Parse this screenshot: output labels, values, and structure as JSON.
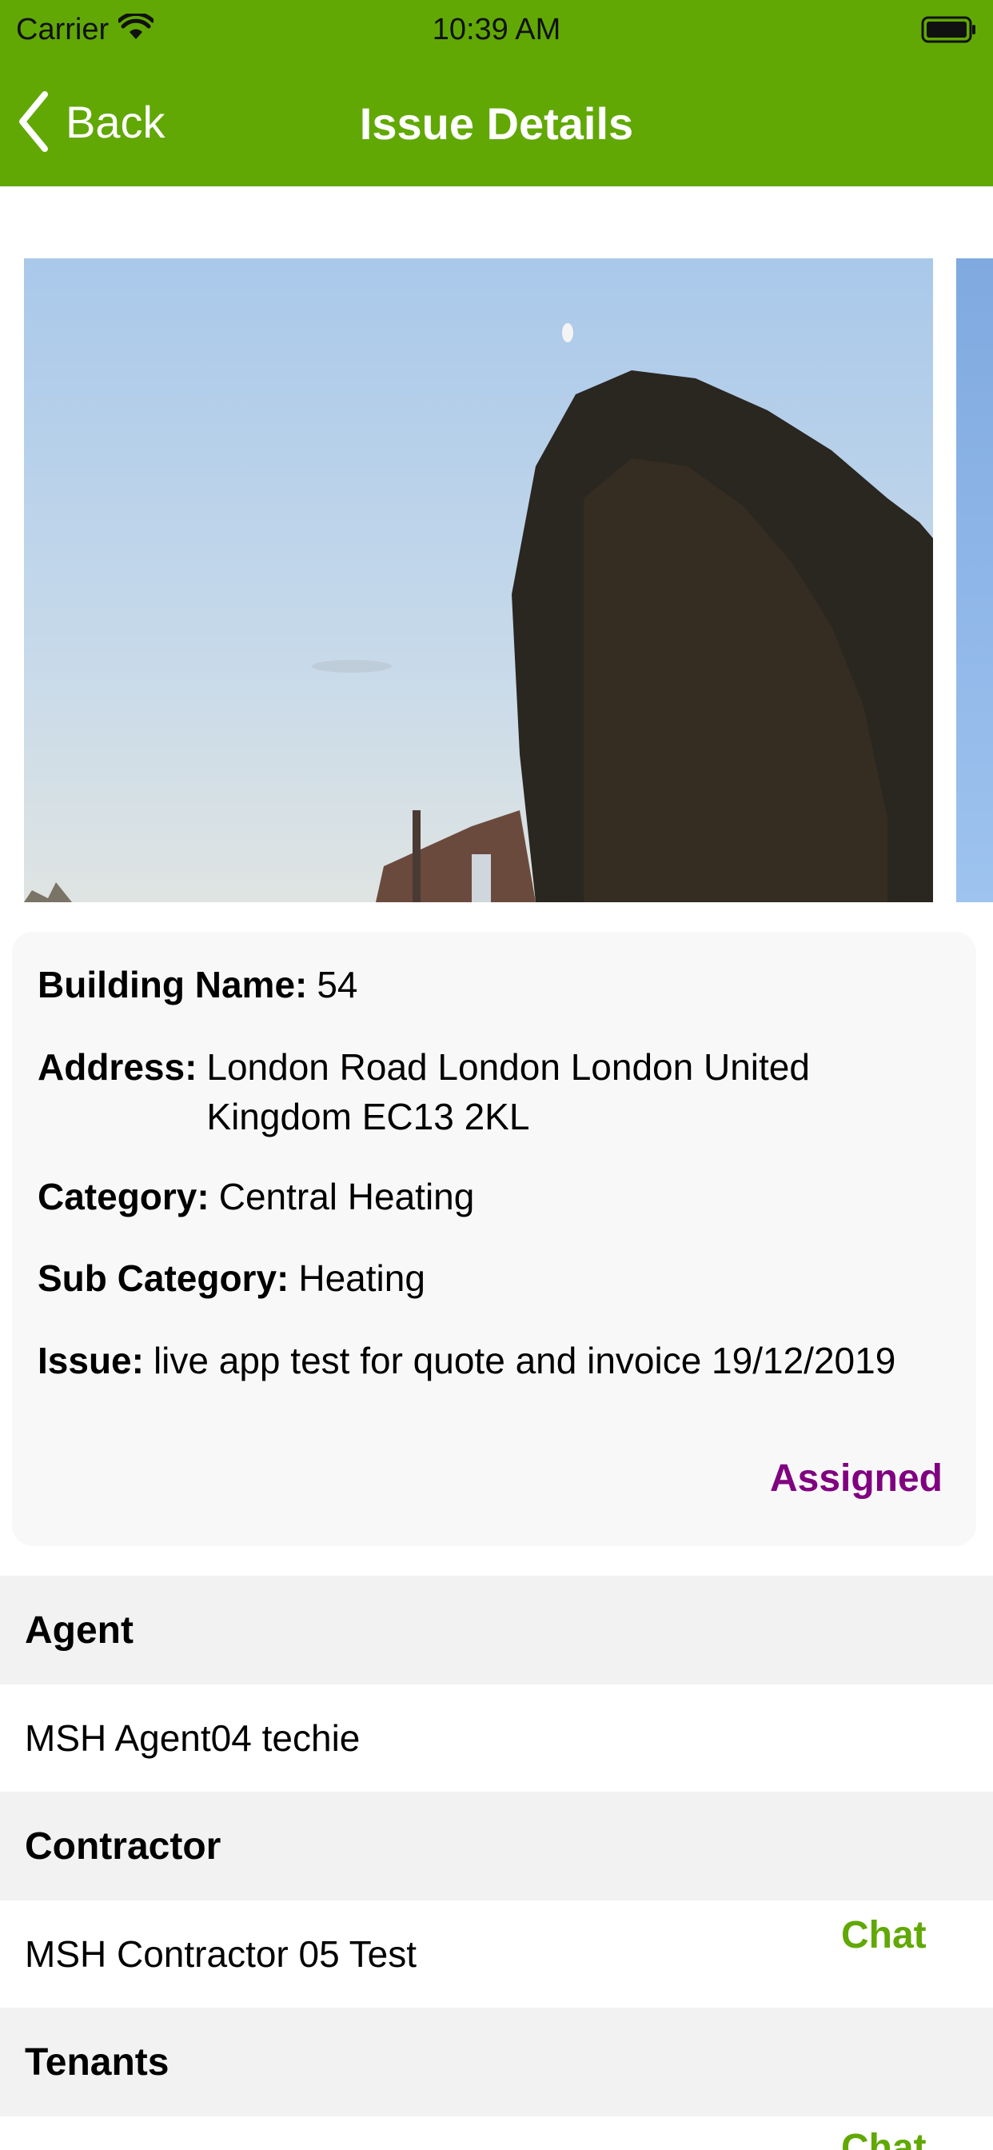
{
  "status_bar": {
    "carrier": "Carrier",
    "time": "10:39 AM",
    "icons": [
      "wifi-icon",
      "battery-icon"
    ]
  },
  "nav": {
    "back_label": "Back",
    "title": "Issue Details",
    "back_icon": "chevron-left-icon"
  },
  "colors": {
    "brand_green": "#61a805",
    "status_purple": "#800080",
    "section_gray": "#f2f2f2",
    "card_gray": "#f8f8f8"
  },
  "details": {
    "building_label": "Building Name:",
    "building_value": "54",
    "address_label": "Address:",
    "address_value": "London Road  London London United Kingdom EC13 2KL",
    "category_label": "Category:",
    "category_value": "Central Heating",
    "subcategory_label": "Sub Category:",
    "subcategory_value": "Heating",
    "issue_label": "Issue:",
    "issue_value": "live app test for quote and invoice 19/12/2019",
    "status": "Assigned"
  },
  "sections": {
    "agent": {
      "header": "Agent",
      "name": "MSH Agent04 techie"
    },
    "contractor": {
      "header": "Contractor",
      "name": "MSH Contractor 05 Test",
      "chat_label": "Chat"
    },
    "tenants": {
      "header": "Tenants",
      "chat_label": "Chat"
    }
  }
}
